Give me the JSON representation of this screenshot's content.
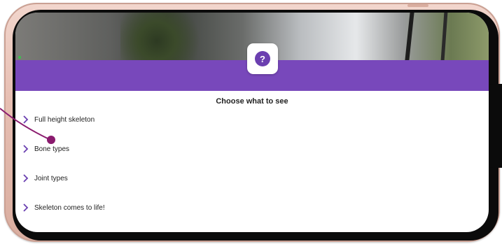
{
  "screen": {
    "title": "Choose what to see",
    "help_icon_glyph": "?",
    "items": [
      {
        "label": "Full height skeleton",
        "icon": "chevron-right-icon"
      },
      {
        "label": "Bone types",
        "icon": "chevron-right-icon"
      },
      {
        "label": "Joint types",
        "icon": "chevron-right-icon"
      },
      {
        "label": "Skeleton comes to life!",
        "icon": "chevron-right-icon"
      }
    ]
  },
  "colors": {
    "accent_purple": "#7848bb",
    "chevron_purple": "#6a3fb0",
    "pointer_magenta": "#8a1b6e"
  }
}
